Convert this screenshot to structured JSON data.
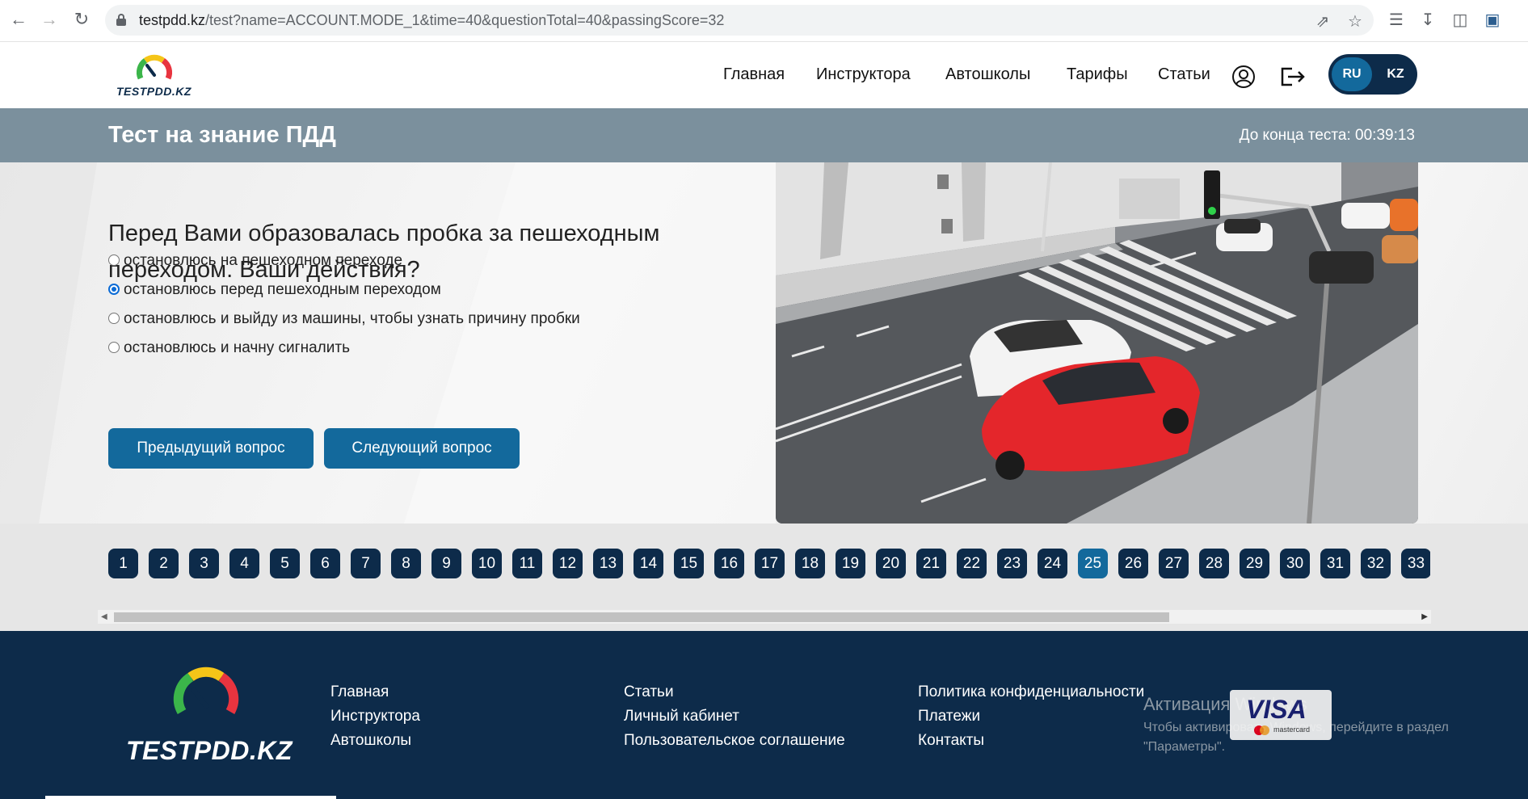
{
  "browser": {
    "url_domain": "testpdd.kz",
    "url_path": "/test?name=ACCOUNT.MODE_1&time=40&questionTotal=40&passingScore=32"
  },
  "header": {
    "logo_text": "TESTPDD.KZ",
    "nav": [
      "Главная",
      "Инструктора",
      "Автошколы",
      "Тарифы",
      "Статьи"
    ],
    "lang_ru": "RU",
    "lang_kz": "KZ"
  },
  "test": {
    "title": "Тест на знание ПДД",
    "timer": "До конца теста: 00:39:13",
    "question": "Перед Вами образовалась пробка за пешеходным переходом. Ваши действия?",
    "options": [
      {
        "label": "остановлюсь на пешеходном переходе",
        "checked": false
      },
      {
        "label": "остановлюсь перед пешеходным переходом",
        "checked": true
      },
      {
        "label": "остановлюсь и выйду из машины, чтобы узнать причину пробки",
        "checked": false
      },
      {
        "label": "остановлюсь и начну сигналить",
        "checked": false
      }
    ],
    "prev_button": "Предыдущий вопрос",
    "next_button": "Следующий вопрос"
  },
  "question_numbers": {
    "items": [
      "1",
      "2",
      "3",
      "4",
      "5",
      "6",
      "7",
      "8",
      "9",
      "10",
      "11",
      "12",
      "13",
      "14",
      "15",
      "16",
      "17",
      "18",
      "19",
      "20",
      "21",
      "22",
      "23",
      "24",
      "25",
      "26",
      "27",
      "28",
      "29",
      "30",
      "31",
      "32",
      "33"
    ],
    "active": "25"
  },
  "footer": {
    "logo_text": "TESTPDD.KZ",
    "col1": [
      "Главная",
      "Инструктора",
      "Автошколы"
    ],
    "col2": [
      "Статьи",
      "Личный кабинет",
      "Пользовательское соглашение"
    ],
    "col3": [
      "Политика конфиденциальности",
      "Платежи",
      "Контакты"
    ],
    "payment_visa": "VISA",
    "payment_mc": "mastercard",
    "watermark_title": "Активация Windows",
    "watermark_line1": "Чтобы активировать Windows, перейдите в раздел",
    "watermark_line2": "\"Параметры\"."
  },
  "colors": {
    "navy": "#0d2b4a",
    "accent_blue": "#13699c",
    "title_bar": "#7b909d"
  }
}
